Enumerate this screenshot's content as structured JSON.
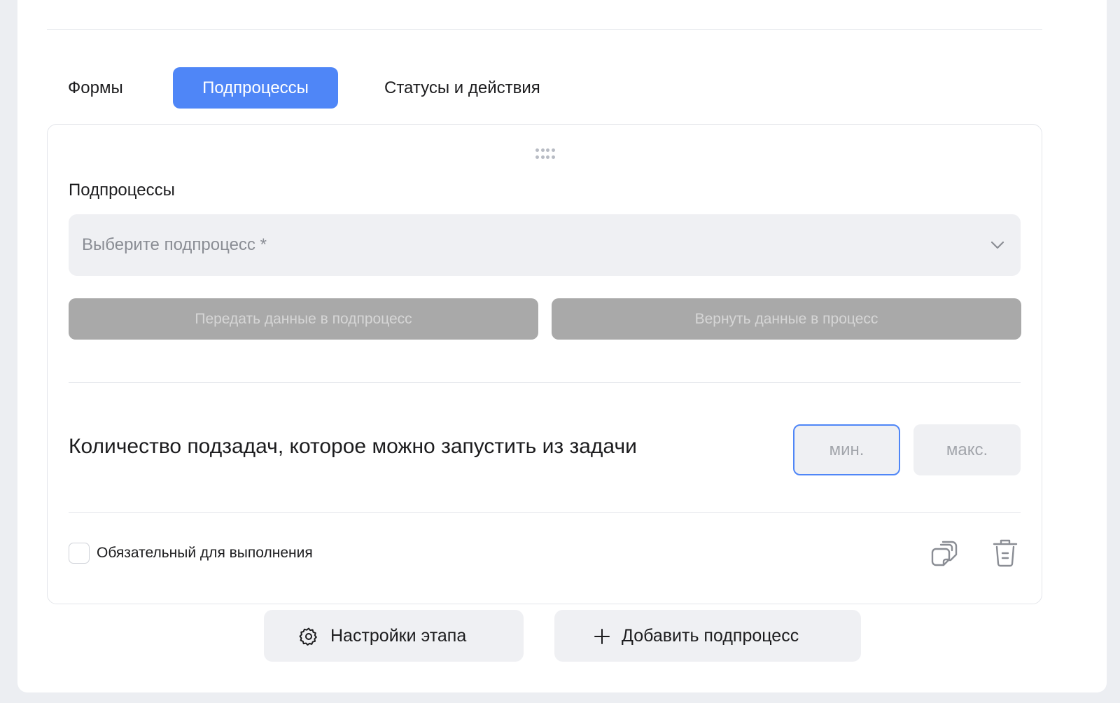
{
  "tabs": [
    {
      "label": "Формы",
      "active": false
    },
    {
      "label": "Подпроцессы",
      "active": true
    },
    {
      "label": "Статусы и действия",
      "active": false
    }
  ],
  "subprocess_card": {
    "title": "Подпроцессы",
    "select_placeholder": "Выберите подпроцесс *",
    "pass_data_button": "Передать данные в подпроцесс",
    "return_data_button": "Вернуть данные в процесс",
    "count_label": "Количество подзадач, которое можно запустить из задачи",
    "min_placeholder": "мин.",
    "max_placeholder": "макс.",
    "required_label": "Обязательный для выполнения",
    "required_checked": false,
    "icons": {
      "drag": "drag-handle-icon",
      "chevron": "chevron-down-icon",
      "copy": "copy-icon",
      "delete": "trash-icon"
    }
  },
  "footer": {
    "settings_button": "Настройки этапа",
    "add_button": "Добавить подпроцесс"
  },
  "colors": {
    "accent": "#4f86f7",
    "disabled_button": "#a9a9a9",
    "field_background": "#eff0f3",
    "page_background": "#eceef2"
  }
}
